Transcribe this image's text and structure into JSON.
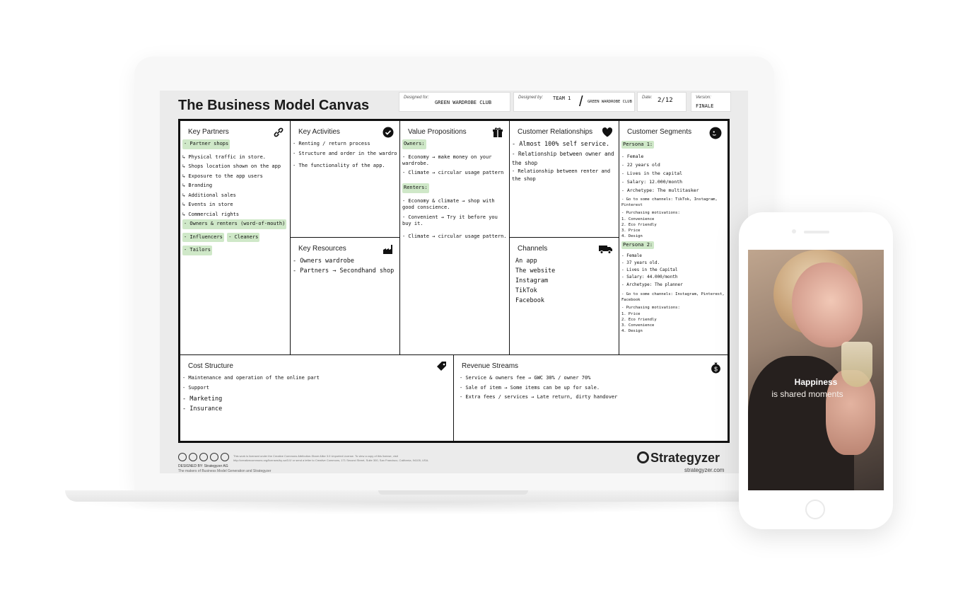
{
  "canvas": {
    "title": "The Business Model Canvas",
    "designed_for_label": "Designed for:",
    "designed_for_value": "GREEN WARDROBE CLUB",
    "designed_by_label": "Designed by:",
    "designed_by_value": "TEAM 1",
    "designed_by_value2": "GREEN WARDROBE CLUB",
    "date_label": "Date:",
    "date_value": "2/12",
    "version_label": "Version:",
    "version_value": "FINALE"
  },
  "blocks": {
    "key_partners": {
      "title": "Key Partners",
      "icon": "link-icon",
      "notes": [
        "- Partner shops",
        "↳ Physical traffic in store.",
        "↳ Shops location shown on the app",
        "↳ Exposure to the app users",
        "↳ Branding",
        "↳ Additional sales",
        "↳ Events in store",
        "↳ Commercial rights",
        "- Owners & renters (word-of-mouth)",
        "- Influencers",
        "- Cleaners",
        "- Tailors"
      ]
    },
    "key_activities": {
      "title": "Key Activities",
      "icon": "check-icon",
      "notes": [
        "- Renting / return process",
        "- Structure and order in the wardrobe",
        "- The functionality of the app."
      ]
    },
    "key_resources": {
      "title": "Key Resources",
      "icon": "factory-icon",
      "notes": [
        "- Owners wardrobe",
        "- Partners → Secondhand shop"
      ]
    },
    "value_propositions": {
      "title": "Value Propositions",
      "icon": "gift-icon",
      "notes": [
        "Owners:",
        "- Economy → make money on your wardrobe.",
        "- Climate → circular usage pattern",
        "Renters:",
        "- Economy & climate → shop with good conscience.",
        "- Convenient → Try it before you buy it.",
        "- Climate → circular usage pattern."
      ]
    },
    "customer_relationships": {
      "title": "Customer Relationships",
      "icon": "heart-icon",
      "notes": [
        "- Almost 100% self service.",
        "- Relationship between owner and the shop",
        "- Relationship between renter and the shop"
      ]
    },
    "channels": {
      "title": "Channels",
      "icon": "truck-icon",
      "notes": [
        "An app",
        "The website",
        "Instagram",
        "TikTok",
        "Facebook"
      ]
    },
    "customer_segments": {
      "title": "Customer Segments",
      "icon": "face-icon",
      "notes": [
        "Persona 1:",
        "- Female",
        "- 22 years old",
        "- Lives in the capital",
        "- Salary: 12.000/month",
        "- Archetype: The multitasker",
        "- Go to some channels: TikTok, Instagram, Pinterest",
        "- Purchasing motivations:",
        "1. Convenience",
        "2. Eco friendly",
        "3. Price",
        "4. Design",
        "Persona 2:",
        "- Female",
        "- 37 years old.",
        "- Lives in the Capital",
        "- Salary: 44.000/month",
        "- Archetype: The planner",
        "- Go to some channels: Instagram, Pinterest, Facebook",
        "- Purchasing motivations:",
        "1. Price",
        "2. Eco friendly",
        "3. Convenience",
        "4. Design"
      ]
    },
    "cost_structure": {
      "title": "Cost Structure",
      "icon": "tag-icon",
      "notes": [
        "- Maintenance and operation of the online part",
        "- Support",
        "- Marketing",
        "- Insurance"
      ]
    },
    "revenue_streams": {
      "title": "Revenue Streams",
      "icon": "money-bag-icon",
      "notes": [
        "- Service & owners fee → GWC 30% / owner 70%",
        "- Sale of item → Some items can be up for sale.",
        "- Extra fees / services → Late return, dirty handover"
      ]
    }
  },
  "footer": {
    "designed_by": "DESIGNED BY: Strategyzer AG",
    "designed_sub": "The makers of Business Model Generation and Strategyzer",
    "license": "This work is licensed under the Creative Commons Attribution-Share Alike 3.0 Unported License. To view a copy of this license, visit http://creativecommons.org/licenses/by-sa/3.0/ or send a letter to Creative Commons, 171 Second Street, Suite 300, San Francisco, California, 94105, USA.",
    "brand": "Strategyzer",
    "brand_url": "strategyzer.com"
  },
  "phone": {
    "headline": "Happiness",
    "subline": "is shared moments"
  }
}
